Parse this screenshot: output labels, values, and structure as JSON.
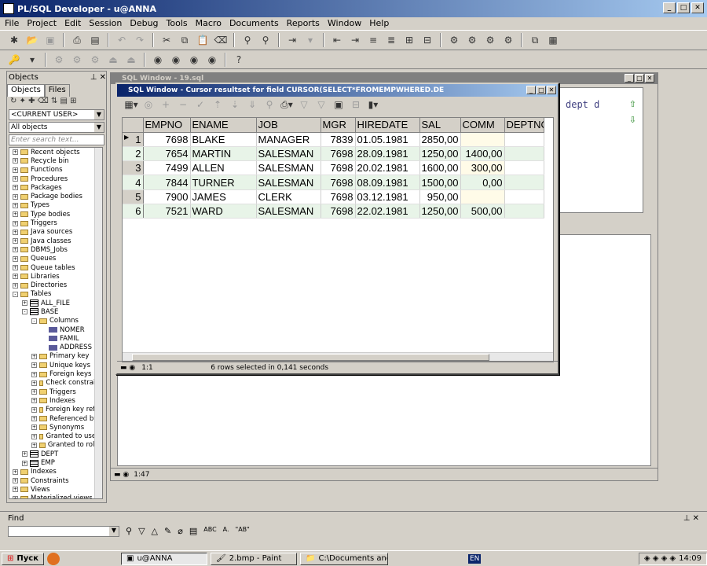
{
  "app": {
    "title": "PL/SQL Developer - u@ANNA"
  },
  "menu": [
    "File",
    "Project",
    "Edit",
    "Session",
    "Debug",
    "Tools",
    "Macro",
    "Documents",
    "Reports",
    "Window",
    "Help"
  ],
  "objects": {
    "title": "Objects",
    "tab_objects": "Objects",
    "tab_files": "Files",
    "user_combo": "<CURRENT USER>",
    "filter_combo": "All objects",
    "search_placeholder": "Enter search text...",
    "tree": [
      {
        "label": "Recent objects",
        "lvl": 0,
        "type": "folder",
        "exp": "+"
      },
      {
        "label": "Recycle bin",
        "lvl": 0,
        "type": "folder",
        "exp": "+"
      },
      {
        "label": "Functions",
        "lvl": 0,
        "type": "folder",
        "exp": "+"
      },
      {
        "label": "Procedures",
        "lvl": 0,
        "type": "folder",
        "exp": "+"
      },
      {
        "label": "Packages",
        "lvl": 0,
        "type": "folder",
        "exp": "+"
      },
      {
        "label": "Package bodies",
        "lvl": 0,
        "type": "folder",
        "exp": "+"
      },
      {
        "label": "Types",
        "lvl": 0,
        "type": "folder",
        "exp": "+"
      },
      {
        "label": "Type bodies",
        "lvl": 0,
        "type": "folder",
        "exp": "+"
      },
      {
        "label": "Triggers",
        "lvl": 0,
        "type": "folder",
        "exp": "+"
      },
      {
        "label": "Java sources",
        "lvl": 0,
        "type": "folder",
        "exp": "+"
      },
      {
        "label": "Java classes",
        "lvl": 0,
        "type": "folder",
        "exp": "+"
      },
      {
        "label": "DBMS_Jobs",
        "lvl": 0,
        "type": "folder",
        "exp": "+"
      },
      {
        "label": "Queues",
        "lvl": 0,
        "type": "folder",
        "exp": "+"
      },
      {
        "label": "Queue tables",
        "lvl": 0,
        "type": "folder",
        "exp": "+"
      },
      {
        "label": "Libraries",
        "lvl": 0,
        "type": "folder",
        "exp": "+"
      },
      {
        "label": "Directories",
        "lvl": 0,
        "type": "folder",
        "exp": "+"
      },
      {
        "label": "Tables",
        "lvl": 0,
        "type": "folder",
        "exp": "-"
      },
      {
        "label": "ALL_FILE",
        "lvl": 1,
        "type": "table",
        "exp": "+"
      },
      {
        "label": "BASE",
        "lvl": 1,
        "type": "table",
        "exp": "-"
      },
      {
        "label": "Columns",
        "lvl": 2,
        "type": "folder",
        "exp": "-"
      },
      {
        "label": "NOMER",
        "lvl": 3,
        "type": "column",
        "exp": ""
      },
      {
        "label": "FAMIL",
        "lvl": 3,
        "type": "column",
        "exp": ""
      },
      {
        "label": "ADDRESS",
        "lvl": 3,
        "type": "column",
        "exp": ""
      },
      {
        "label": "Primary key",
        "lvl": 2,
        "type": "folder",
        "exp": "+"
      },
      {
        "label": "Unique keys",
        "lvl": 2,
        "type": "folder",
        "exp": "+"
      },
      {
        "label": "Foreign keys",
        "lvl": 2,
        "type": "folder",
        "exp": "+"
      },
      {
        "label": "Check constraint",
        "lvl": 2,
        "type": "folder",
        "exp": "+"
      },
      {
        "label": "Triggers",
        "lvl": 2,
        "type": "folder",
        "exp": "+"
      },
      {
        "label": "Indexes",
        "lvl": 2,
        "type": "folder",
        "exp": "+"
      },
      {
        "label": "Foreign key refer",
        "lvl": 2,
        "type": "folder",
        "exp": "+"
      },
      {
        "label": "Referenced by",
        "lvl": 2,
        "type": "folder",
        "exp": "+"
      },
      {
        "label": "Synonyms",
        "lvl": 2,
        "type": "folder",
        "exp": "+"
      },
      {
        "label": "Granted to users",
        "lvl": 2,
        "type": "folder",
        "exp": "+"
      },
      {
        "label": "Granted to roles",
        "lvl": 2,
        "type": "folder",
        "exp": "+"
      },
      {
        "label": "DEPT",
        "lvl": 1,
        "type": "table",
        "exp": "+"
      },
      {
        "label": "EMP",
        "lvl": 1,
        "type": "table",
        "exp": "+"
      },
      {
        "label": "Indexes",
        "lvl": 0,
        "type": "folder",
        "exp": "+"
      },
      {
        "label": "Constraints",
        "lvl": 0,
        "type": "folder",
        "exp": "+"
      },
      {
        "label": "Views",
        "lvl": 0,
        "type": "folder",
        "exp": "+"
      },
      {
        "label": "Materialized views",
        "lvl": 0,
        "type": "folder",
        "exp": "+"
      }
    ]
  },
  "sql_window": {
    "title": "SQL Window - 19.sql",
    "code_fragment": "dept d",
    "status_pos": "1:47"
  },
  "result_window": {
    "title": "SQL Window - Cursor resultset for field CURSOR(SELECT*FROMEMPWHERED.DE",
    "status_pos": "1:1",
    "status_msg": "6 rows selected in 0,141 seconds",
    "columns": [
      "EMPNO",
      "ENAME",
      "JOB",
      "MGR",
      "HIREDATE",
      "SAL",
      "COMM",
      "DEPTNO"
    ],
    "rows": [
      [
        "1",
        "7698",
        "BLAKE",
        "MANAGER",
        "7839",
        "01.05.1981",
        "2850,00",
        ""
      ],
      [
        "2",
        "7654",
        "MARTIN",
        "SALESMAN",
        "7698",
        "28.09.1981",
        "1250,00",
        "1400,00"
      ],
      [
        "3",
        "7499",
        "ALLEN",
        "SALESMAN",
        "7698",
        "20.02.1981",
        "1600,00",
        "300,00"
      ],
      [
        "4",
        "7844",
        "TURNER",
        "SALESMAN",
        "7698",
        "08.09.1981",
        "1500,00",
        "0,00"
      ],
      [
        "5",
        "7900",
        "JAMES",
        "CLERK",
        "7698",
        "03.12.1981",
        "950,00",
        ""
      ],
      [
        "6",
        "7521",
        "WARD",
        "SALESMAN",
        "7698",
        "22.02.1981",
        "1250,00",
        "500,00"
      ]
    ]
  },
  "find": {
    "label": "Find"
  },
  "taskbar": {
    "start": "Пуск",
    "tasks": [
      "u@ANNA",
      "2.bmp - Paint",
      "C:\\Documents and Settin..."
    ],
    "lang": "EN",
    "time": "14:09"
  }
}
